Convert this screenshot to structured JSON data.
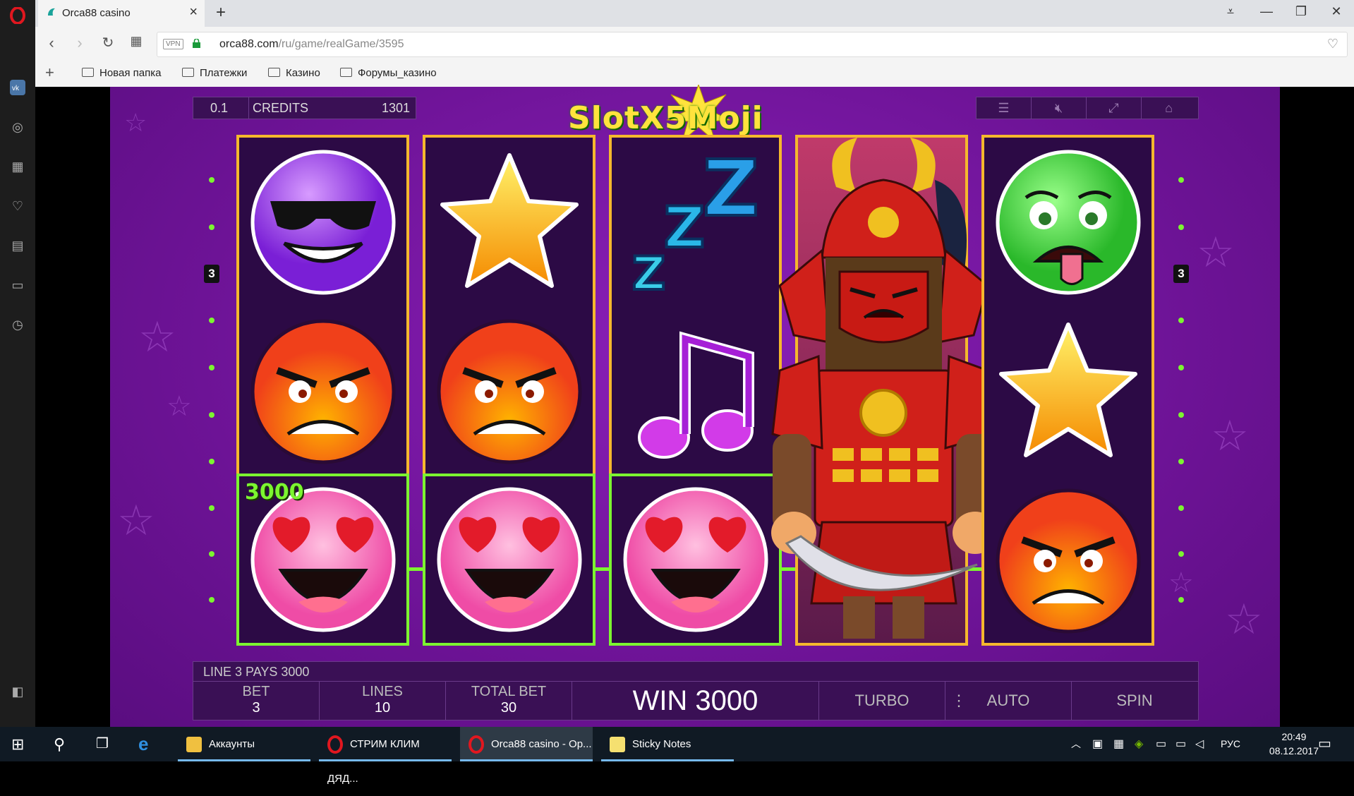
{
  "browser": {
    "tab_title": "Orca88 casino",
    "url_host": "orca88.com",
    "url_path": "/ru/game/realGame/3595",
    "vpn_label": "VPN",
    "bookmarks": [
      "Новая папка",
      "Платежки",
      "Казино",
      "Форумы_казино"
    ]
  },
  "game": {
    "logo": "SlotX5Moji",
    "hud_top": {
      "denom": "0.1",
      "credits_label": "CREDITS",
      "credits_value": "1301"
    },
    "hud_icons": [
      "menu-icon",
      "mute-icon",
      "fullscreen-icon",
      "home-icon"
    ],
    "reels": [
      [
        "cool-sunglasses-emoji",
        "angry-emoji",
        "heart-eyes-emoji"
      ],
      [
        "star-symbol",
        "angry-emoji",
        "heart-eyes-emoji"
      ],
      [
        "zzz-symbol",
        "music-note-symbol",
        "heart-eyes-emoji"
      ],
      [
        "samurai-wild",
        "samurai-wild",
        "samurai-wild"
      ],
      [
        "sick-emoji",
        "star-symbol",
        "angry-emoji"
      ]
    ],
    "win_amount_label": "3000",
    "line_number": "3",
    "pays_text": "LINE 3 PAYS 3000",
    "bottom": {
      "bet_label": "BET",
      "bet_value": "3",
      "lines_label": "LINES",
      "lines_value": "10",
      "total_bet_label": "TOTAL BET",
      "total_bet_value": "30",
      "win_text": "WIN 3000",
      "turbo_label": "TURBO",
      "auto_label": "AUTO",
      "spin_label": "SPIN"
    }
  },
  "taskbar": {
    "items": [
      "Аккаунты",
      "СТРИМ КЛИМ ДЯД...",
      "Orca88 casino - Op...",
      "Sticky Notes"
    ],
    "lang": "РУС",
    "time": "20:49",
    "date": "08.12.2017"
  },
  "colors": {
    "accent_green": "#7cf530",
    "reel_border": "#f5b82d",
    "bg_purple": "#6d1396"
  }
}
